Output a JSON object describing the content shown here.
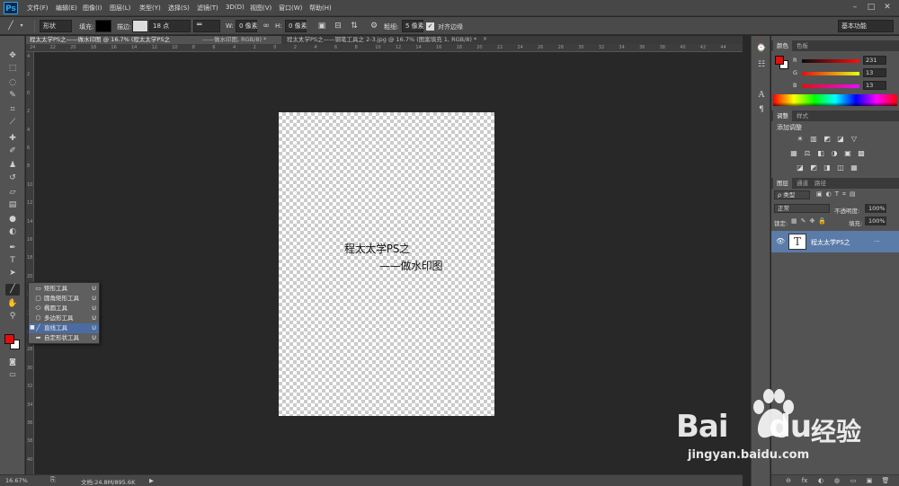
{
  "app": {
    "logo": "Ps",
    "menu": [
      "文件(F)",
      "编辑(E)",
      "图像(I)",
      "图层(L)",
      "类型(Y)",
      "选择(S)",
      "滤镜(T)",
      "3D(D)",
      "视图(V)",
      "窗口(W)",
      "帮助(H)"
    ],
    "window_buttons": [
      "–",
      "□",
      "✕"
    ]
  },
  "options": {
    "tool_mode": "形状",
    "fill_label": "填充:",
    "stroke_label": "描边:",
    "stroke_size": "18 点",
    "w_label": "W:",
    "w_value": "0 像素",
    "h_label": "H:",
    "h_value": "0 像素",
    "weight_label": "粗细:",
    "weight_value": "5 像素",
    "align_edges": "对齐边缘",
    "workspace": "基本功能",
    "fill_color": "#000000"
  },
  "tabs": [
    {
      "label": "程太太学PS之——做水印图 @ 16.7% (程太太学PS之",
      "close": "×"
    },
    {
      "label": "——做水印图, RGB/8) *",
      "close": "×"
    },
    {
      "label": "程太太学PS之——钢笔工具之 2-3.jpg @ 16.7% (图案填充 1, RGB/8) *",
      "close": "×"
    }
  ],
  "rulers": {
    "top": [
      "24",
      "22",
      "20",
      "18",
      "16",
      "14",
      "12",
      "10",
      "8",
      "6",
      "4",
      "2",
      "0",
      "2",
      "4",
      "6",
      "8",
      "10",
      "12",
      "14",
      "16",
      "18",
      "20",
      "22",
      "24",
      "26",
      "28",
      "30",
      "32",
      "34",
      "36",
      "38",
      "40",
      "42",
      "44"
    ],
    "left": [
      "4",
      "2",
      "0",
      "2",
      "4",
      "6",
      "8",
      "10",
      "12",
      "14",
      "16",
      "18",
      "20",
      "22",
      "24",
      "26",
      "28",
      "30",
      "32",
      "34",
      "36",
      "38",
      "40"
    ]
  },
  "tools": [
    {
      "name": "move-tool",
      "glyph": "✥"
    },
    {
      "name": "marquee-tool",
      "glyph": "⬚"
    },
    {
      "name": "lasso-tool",
      "glyph": "◌"
    },
    {
      "name": "quick-select-tool",
      "glyph": "✎"
    },
    {
      "name": "crop-tool",
      "glyph": "⌗"
    },
    {
      "name": "eyedropper-tool",
      "glyph": "⟋"
    },
    {
      "name": "healing-tool",
      "glyph": "✚"
    },
    {
      "name": "brush-tool",
      "glyph": "✐"
    },
    {
      "name": "stamp-tool",
      "glyph": "♟"
    },
    {
      "name": "history-brush-tool",
      "glyph": "↺"
    },
    {
      "name": "eraser-tool",
      "glyph": "▱"
    },
    {
      "name": "gradient-tool",
      "glyph": "▤"
    },
    {
      "name": "blur-tool",
      "glyph": "●"
    },
    {
      "name": "dodge-tool",
      "glyph": "◐"
    },
    {
      "name": "pen-tool",
      "glyph": "✒"
    },
    {
      "name": "type-tool",
      "glyph": "T"
    },
    {
      "name": "path-select-tool",
      "glyph": "➤"
    },
    {
      "name": "line-tool",
      "glyph": "╱"
    },
    {
      "name": "hand-tool",
      "glyph": "✋"
    },
    {
      "name": "zoom-tool",
      "glyph": "⚲"
    }
  ],
  "flyout": [
    {
      "label": "矩形工具",
      "key": "U",
      "icon": "▭"
    },
    {
      "label": "圆角矩形工具",
      "key": "U",
      "icon": "▢"
    },
    {
      "label": "椭圆工具",
      "key": "U",
      "icon": "⬭"
    },
    {
      "label": "多边形工具",
      "key": "U",
      "icon": "⬡"
    },
    {
      "label": "直线工具",
      "key": "U",
      "icon": "╱"
    },
    {
      "label": "自定形状工具",
      "key": "U",
      "icon": "➡"
    }
  ],
  "canvas": {
    "line1": "程太太学PS之",
    "line2": "——做水印图"
  },
  "status": {
    "zoom": "16.67%",
    "doc": "文档:24.8M/895.6K",
    "arrow": "▶"
  },
  "color_panel": {
    "tabs": [
      "颜色",
      "色板"
    ],
    "channels": [
      {
        "label": "R",
        "value": "231"
      },
      {
        "label": "G",
        "value": "13"
      },
      {
        "label": "B",
        "value": "13"
      }
    ],
    "foreground": "#e70d0d",
    "background": "#ffffff"
  },
  "adjust_panel": {
    "tabs": [
      "调整",
      "样式"
    ],
    "title": "添加调整",
    "row1": [
      "☀",
      "▥",
      "◩",
      "◪",
      "▽"
    ],
    "row2": [
      "▦",
      "⚖",
      "◧",
      "◑",
      "▣",
      "▩"
    ],
    "row3": [
      "◪",
      "◩",
      "◨",
      "◫",
      "▦"
    ]
  },
  "layers_panel": {
    "tabs": [
      "图层",
      "通道",
      "路径"
    ],
    "filter": "ρ 类型",
    "blend_mode": "正常",
    "opacity_label": "不透明度:",
    "opacity_value": "100%",
    "lock_label": "锁定:",
    "fill_label": "填充:",
    "fill_value": "100%",
    "layer_name": "程太太学PS之",
    "layer_thumb": "T",
    "layer_dots": "...",
    "bottom_icons": [
      "⊖",
      "fx",
      "◐",
      "◍",
      "▭",
      "▣",
      "🗑"
    ]
  },
  "watermark": {
    "brand": "Bai",
    "brand2": "du",
    "suffix": "经验",
    "url": "jingyan.baidu.com"
  }
}
